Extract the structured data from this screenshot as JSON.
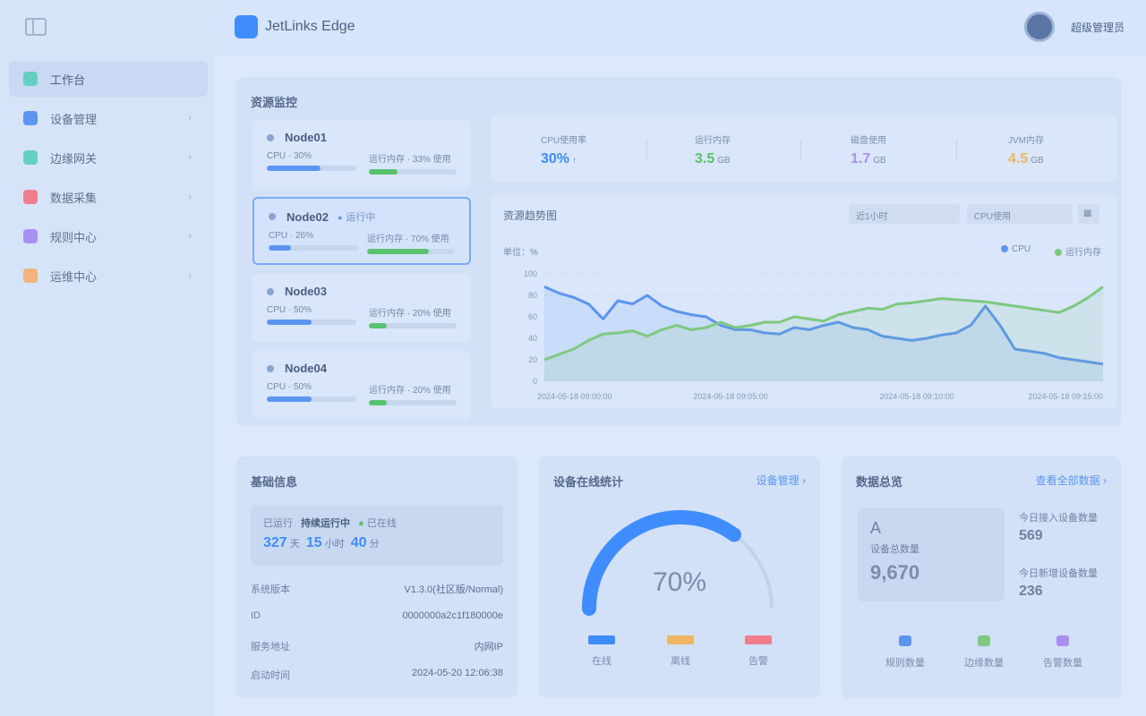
{
  "app": {
    "title": "JetLinks Edge"
  },
  "user": {
    "name": "超级管理员"
  },
  "sidebar": {
    "items": [
      {
        "label": "工作台",
        "color": "#64d0c4",
        "active": true,
        "chevron": ""
      },
      {
        "label": "设备管理",
        "color": "#5c95f0",
        "active": false,
        "chevron": "›"
      },
      {
        "label": "边缘网关",
        "color": "#64d0c4",
        "active": false,
        "chevron": "›"
      },
      {
        "label": "数据采集",
        "color": "#f07d8c",
        "active": false,
        "chevron": "›"
      },
      {
        "label": "规则中心",
        "color": "#a88ff3",
        "active": false,
        "chevron": "›"
      },
      {
        "label": "运维中心",
        "color": "#f3b37d",
        "active": false,
        "chevron": "›"
      }
    ]
  },
  "monitor": {
    "title": "资源监控",
    "devices": [
      {
        "name": "Node01",
        "tag": "",
        "cpu_label": "CPU · 30%",
        "mem_label": "运行内存 · 33% 使用",
        "cpu": 0.6,
        "mem": 0.33
      },
      {
        "name": "Node02",
        "tag": "运行中",
        "cpu_label": "CPU · 26%",
        "mem_label": "运行内存 · 70% 使用",
        "cpu": 0.25,
        "mem": 0.7
      },
      {
        "name": "Node03",
        "tag": "",
        "cpu_label": "CPU · 50%",
        "mem_label": "运行内存 · 20% 使用",
        "cpu": 0.5,
        "mem": 0.2
      },
      {
        "name": "Node04",
        "tag": "",
        "cpu_label": "CPU · 50%",
        "mem_label": "运行内存 · 20% 使用",
        "cpu": 0.5,
        "mem": 0.2
      }
    ],
    "stats": [
      {
        "label": "CPU使用率",
        "value": "30%",
        "unit": "↑",
        "color": "#3f8cff"
      },
      {
        "label": "运行内存",
        "value": "3.5",
        "unit": "GB",
        "color": "#58c26d"
      },
      {
        "label": "磁盘使用",
        "value": "1.7",
        "unit": "GB",
        "color": "#a88ff3"
      },
      {
        "label": "JVM内存",
        "value": "4.5",
        "unit": "GB",
        "color": "#f0b560"
      }
    ]
  },
  "chart_header": {
    "title": "资源趋势图",
    "select1": "近1小时",
    "select2": "CPU使用",
    "unit_label": "单位：%",
    "legend": [
      "CPU",
      "运行内存"
    ]
  },
  "chart_data": {
    "type": "line",
    "x": [
      "2024-05-18 09:00:00",
      "2024-05-18 09:05:00",
      "2024-05-18 09:10:00",
      "2024-05-18 09:15:00"
    ],
    "ylim": [
      0,
      100
    ],
    "yticks": [
      0,
      20,
      40,
      60,
      80,
      100
    ],
    "series": [
      {
        "name": "CPU",
        "color": "#5c95f0",
        "values": [
          88,
          82,
          78,
          72,
          58,
          75,
          72,
          80,
          70,
          65,
          62,
          60,
          52,
          48,
          48,
          45,
          44,
          50,
          48,
          52,
          55,
          50,
          48,
          42,
          40,
          38,
          40,
          43,
          45,
          52,
          70,
          52,
          30,
          28,
          26,
          22,
          20,
          18,
          16
        ]
      },
      {
        "name": "运行内存",
        "color": "#7dc97f",
        "values": [
          20,
          25,
          30,
          38,
          44,
          45,
          47,
          42,
          48,
          52,
          48,
          50,
          55,
          50,
          52,
          55,
          55,
          60,
          58,
          56,
          62,
          65,
          68,
          67,
          72,
          73,
          75,
          77,
          76,
          75,
          74,
          72,
          70,
          68,
          66,
          64,
          70,
          78,
          88
        ]
      }
    ]
  },
  "basic_info": {
    "title": "基础信息",
    "summary_prefix": "已运行",
    "summary_highlight": "持续运行中",
    "summary_status": "已在线",
    "uptime": {
      "d": "327",
      "d_unit": "天",
      "h": "15",
      "h_unit": "小时",
      "m": "40",
      "m_unit": "分"
    },
    "rows": [
      {
        "k": "系统版本",
        "v": "V1.3.0(社区版/Normal)"
      },
      {
        "k": "ID",
        "v": "0000000a2c1f180000e"
      },
      {
        "k": "服务地址",
        "v": "内网IP"
      },
      {
        "k": "启动时间",
        "v": "2024-05-20 12:06:38"
      }
    ]
  },
  "gauge": {
    "title": "设备在线统计",
    "link": "设备管理",
    "value": 0.7,
    "value_label": "70%",
    "legend": [
      {
        "label": "在线",
        "color": "#3f8cff"
      },
      {
        "label": "离线",
        "color": "#f0b560"
      },
      {
        "label": "告警",
        "color": "#f07d8c"
      }
    ]
  },
  "overview": {
    "title": "数据总览",
    "link": "查看全部数据",
    "big_label": "设备总数量",
    "big_value": "9,670",
    "side": [
      {
        "label": "今日接入设备数量",
        "value": "569"
      },
      {
        "label": "今日新增设备数量",
        "value": "236"
      }
    ],
    "items": [
      {
        "label": "规则数量",
        "color": "#5c95f0"
      },
      {
        "label": "边缘数量",
        "color": "#7dc97f"
      },
      {
        "label": "告警数量",
        "color": "#a88ff3"
      }
    ]
  }
}
